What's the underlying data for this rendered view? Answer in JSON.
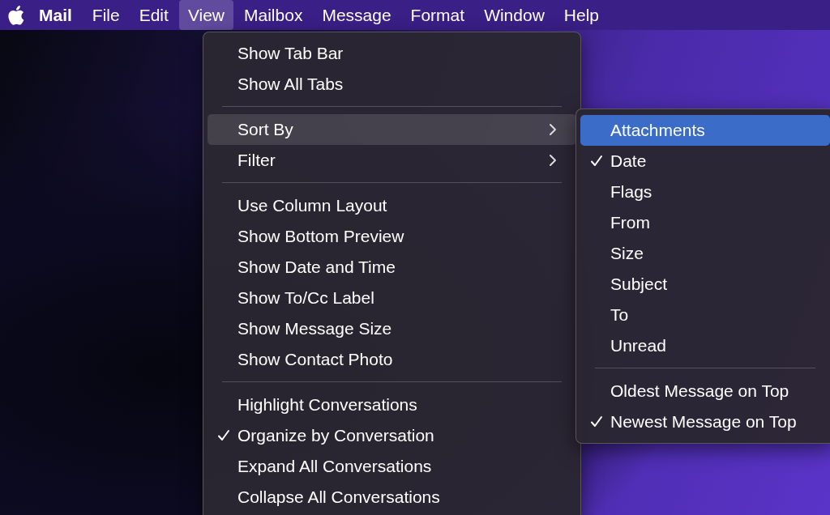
{
  "menu_bar": {
    "app_name": "Mail",
    "items": [
      {
        "label": "File",
        "selected": false
      },
      {
        "label": "Edit",
        "selected": false
      },
      {
        "label": "View",
        "selected": true
      },
      {
        "label": "Mailbox",
        "selected": false
      },
      {
        "label": "Message",
        "selected": false
      },
      {
        "label": "Format",
        "selected": false
      },
      {
        "label": "Window",
        "selected": false
      },
      {
        "label": "Help",
        "selected": false
      }
    ]
  },
  "view_menu": {
    "items": [
      {
        "kind": "item",
        "label": "Show Tab Bar",
        "checked": false,
        "selected": false
      },
      {
        "kind": "item",
        "label": "Show All Tabs",
        "checked": false,
        "selected": false
      },
      {
        "kind": "separator"
      },
      {
        "kind": "submenu",
        "label": "Sort By",
        "checked": false,
        "selected": true
      },
      {
        "kind": "submenu",
        "label": "Filter",
        "checked": false,
        "selected": false
      },
      {
        "kind": "separator"
      },
      {
        "kind": "item",
        "label": "Use Column Layout",
        "checked": false,
        "selected": false
      },
      {
        "kind": "item",
        "label": "Show Bottom Preview",
        "checked": false,
        "selected": false
      },
      {
        "kind": "item",
        "label": "Show Date and Time",
        "checked": false,
        "selected": false
      },
      {
        "kind": "item",
        "label": "Show To/Cc Label",
        "checked": false,
        "selected": false
      },
      {
        "kind": "item",
        "label": "Show Message Size",
        "checked": false,
        "selected": false
      },
      {
        "kind": "item",
        "label": "Show Contact Photo",
        "checked": false,
        "selected": false
      },
      {
        "kind": "separator"
      },
      {
        "kind": "item",
        "label": "Highlight Conversations",
        "checked": false,
        "selected": false
      },
      {
        "kind": "item",
        "label": "Organize by Conversation",
        "checked": true,
        "selected": false
      },
      {
        "kind": "item",
        "label": "Expand All Conversations",
        "checked": false,
        "selected": false
      },
      {
        "kind": "item",
        "label": "Collapse All Conversations",
        "checked": false,
        "selected": false
      }
    ]
  },
  "sort_by_submenu": {
    "items": [
      {
        "kind": "item",
        "label": "Attachments",
        "checked": false,
        "selected": true
      },
      {
        "kind": "item",
        "label": "Date",
        "checked": true,
        "selected": false
      },
      {
        "kind": "item",
        "label": "Flags",
        "checked": false,
        "selected": false
      },
      {
        "kind": "item",
        "label": "From",
        "checked": false,
        "selected": false
      },
      {
        "kind": "item",
        "label": "Size",
        "checked": false,
        "selected": false
      },
      {
        "kind": "item",
        "label": "Subject",
        "checked": false,
        "selected": false
      },
      {
        "kind": "item",
        "label": "To",
        "checked": false,
        "selected": false
      },
      {
        "kind": "item",
        "label": "Unread",
        "checked": false,
        "selected": false
      },
      {
        "kind": "separator"
      },
      {
        "kind": "item",
        "label": "Oldest Message on Top",
        "checked": false,
        "selected": false
      },
      {
        "kind": "item",
        "label": "Newest Message on Top",
        "checked": true,
        "selected": false
      }
    ]
  }
}
